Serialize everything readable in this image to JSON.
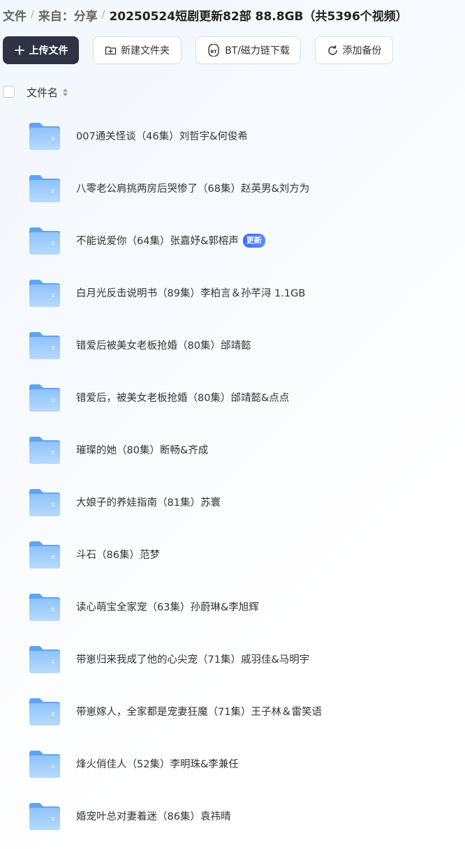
{
  "breadcrumb": {
    "root": "文件",
    "from": "来自：分享",
    "current": "20250524短剧更新82部 88.8GB（共5396个视频）"
  },
  "toolbar": {
    "upload": "上传文件",
    "new_folder": "新建文件夹",
    "bt_download": "BT/磁力链下载",
    "add_backup": "添加备份"
  },
  "table": {
    "col_name": "文件名"
  },
  "files": [
    {
      "name": "007通关怪谈（46集）刘哲宇&何俊希"
    },
    {
      "name": "八零老公肩挑两房后哭惨了（68集）赵英男&刘方为"
    },
    {
      "name": "不能说爱你（64集）张嘉妤&郭榕声",
      "badge": "更新"
    },
    {
      "name": "白月光反击说明书（89集）李柏言＆孙芊浔 1.1GB"
    },
    {
      "name": "错爱后被美女老板抢婚（80集）邰靖懿"
    },
    {
      "name": "错爱后，被美女老板抢婚（80集）邰靖懿&点点"
    },
    {
      "name": "璀璨的她（80集）断畅&齐成"
    },
    {
      "name": "大娘子的养娃指南（81集）苏寰"
    },
    {
      "name": "斗石（86集）范梦"
    },
    {
      "name": "读心萌宝全家宠（63集）孙蔚琳&李旭辉"
    },
    {
      "name": "带崽归来我成了他的心尖宠（71集）戚羽佳&马明宇"
    },
    {
      "name": "带崽嫁人，全家都是宠妻狂魔（71集）王子林＆雷笑语"
    },
    {
      "name": "烽火俏佳人（52集）李明珠&李兼任"
    },
    {
      "name": "婚宠叶总对妻着迷（86集）袁祎晴"
    }
  ]
}
